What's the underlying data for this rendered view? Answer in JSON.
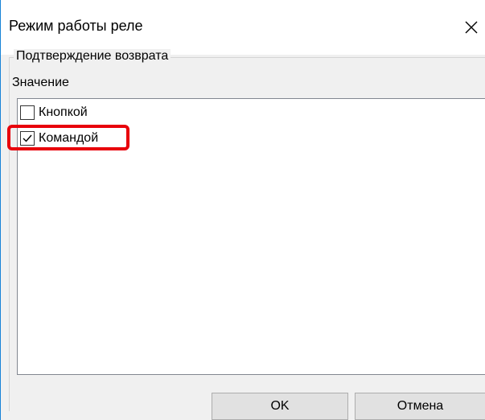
{
  "window": {
    "title": "Режим работы реле",
    "close_icon": "close-icon"
  },
  "group": {
    "legend": "Подтверждение возврата"
  },
  "field": {
    "label": "Значение"
  },
  "options": [
    {
      "label": "Кнопкой",
      "checked": false
    },
    {
      "label": "Командой",
      "checked": true
    }
  ],
  "highlight": {
    "target": "Командой",
    "color": "#e8000b"
  },
  "buttons": {
    "ok_label": "OK",
    "cancel_label": "Отмена"
  },
  "colors": {
    "window_bg": "#f0f0f0",
    "list_bg": "#ffffff",
    "accent_border": "#1883d7"
  }
}
